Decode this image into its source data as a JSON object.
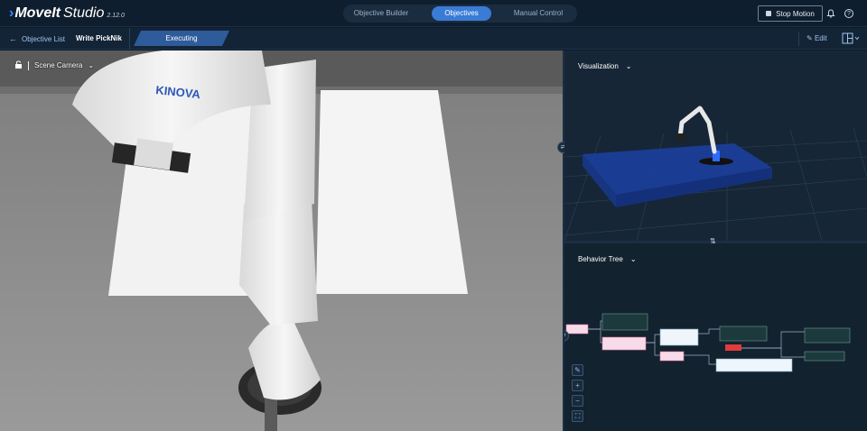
{
  "app": {
    "brand": "MoveIt",
    "product": "Studio",
    "version": "2.12.0",
    "accent_color": "#3a7bd5"
  },
  "top_tabs": [
    {
      "label": "Objective Builder",
      "active": false
    },
    {
      "label": "Objectives",
      "active": true
    },
    {
      "label": "Manual Control",
      "active": false
    }
  ],
  "toolbar": {
    "stop_label": "Stop Motion",
    "bell_icon": "bell-icon",
    "help_icon": "help-icon"
  },
  "subbar": {
    "back_label": "Objective List",
    "objective_name": "Write PickNik",
    "status": "Executing",
    "edit_label": "Edit",
    "layout_icon": "layout-grid-icon"
  },
  "camera_panel": {
    "title": "Scene Camera",
    "robot_label": "KINOVA"
  },
  "viz_panel": {
    "title": "Visualization"
  },
  "bt_panel": {
    "title": "Behavior Tree"
  }
}
